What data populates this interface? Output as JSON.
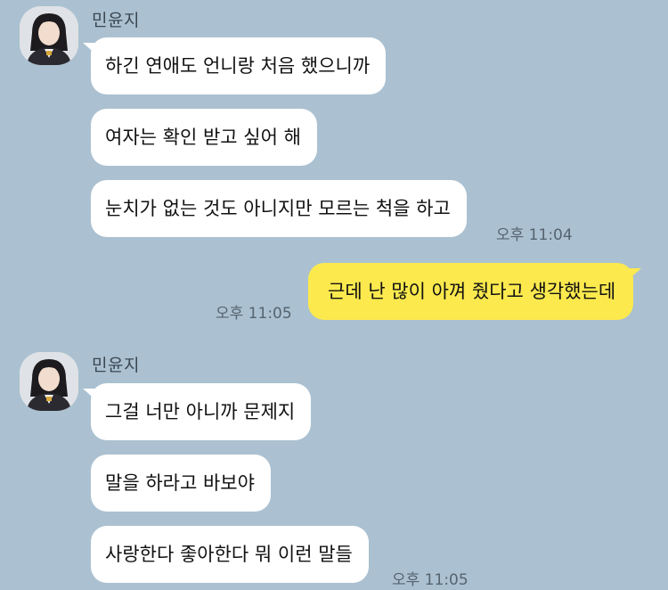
{
  "theme": {
    "background": "#abc1d1",
    "incoming_bubble": "#ffffff",
    "outgoing_bubble": "#fbe94e"
  },
  "groups": [
    {
      "sender": "민윤지",
      "avatar": "profile-avatar",
      "messages": [
        "하긴 연애도 언니랑 처음 했으니까",
        "여자는 확인 받고 싶어 해",
        "눈치가 없는 것도 아니지만 모르는 척을 하고"
      ],
      "time": "오후 11:04"
    },
    {
      "outgoing": true,
      "messages": [
        "근데 난 많이 아껴 줬다고 생각했는데"
      ],
      "time": "오후 11:05"
    },
    {
      "sender": "민윤지",
      "avatar": "profile-avatar",
      "messages": [
        "그걸 너만 아니까 문제지",
        "말을 하라고 바보야",
        "사랑한다 좋아한다 뭐 이런 말들"
      ],
      "time": "오후 11:05"
    }
  ]
}
